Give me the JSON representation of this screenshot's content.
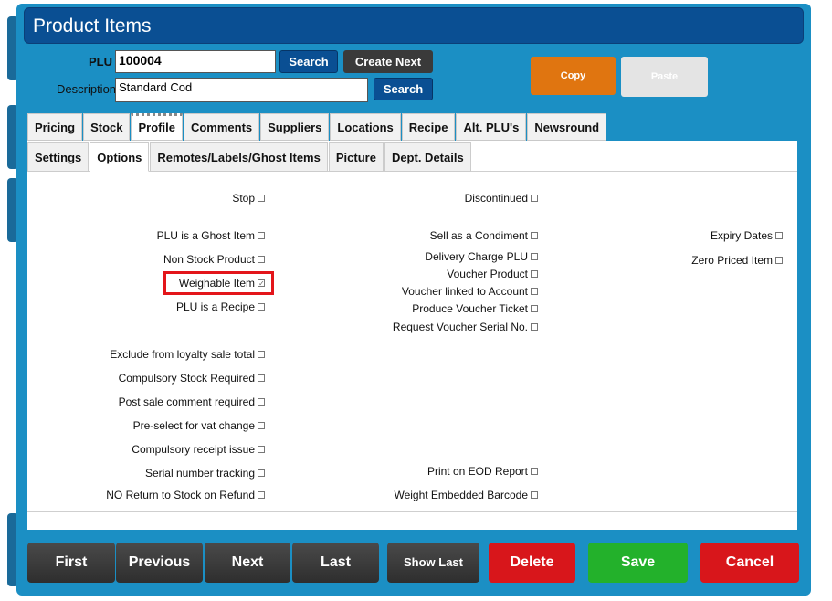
{
  "window": {
    "title": "Product Items"
  },
  "header": {
    "plu_label": "PLU",
    "plu_value": "100004",
    "description_label": "Description",
    "description_value": "Standard Cod",
    "search_label": "Search",
    "search2_label": "Search",
    "create_next_label": "Create Next",
    "copy_label": "Copy",
    "paste_label": "Paste"
  },
  "tabs": [
    "Pricing",
    "Stock",
    "Profile",
    "Comments",
    "Suppliers",
    "Locations",
    "Recipe",
    "Alt. PLU's",
    "Newsround"
  ],
  "active_tab": "Profile",
  "subtabs": [
    "Settings",
    "Options",
    "Remotes/Labels/Ghost Items",
    "Picture",
    "Dept. Details"
  ],
  "active_subtab": "Options",
  "options": {
    "col1": [
      {
        "label": "Stop",
        "checked": false
      },
      {
        "label": "PLU is a Ghost Item",
        "checked": false
      },
      {
        "label": "Non Stock Product",
        "checked": false
      },
      {
        "label": "Weighable Item",
        "checked": true
      },
      {
        "label": "PLU is a Recipe",
        "checked": false
      },
      {
        "label": "Exclude from loyalty sale total",
        "checked": false
      },
      {
        "label": "Compulsory Stock Required",
        "checked": false
      },
      {
        "label": "Post sale comment required",
        "checked": false
      },
      {
        "label": "Pre-select for vat change",
        "checked": false
      },
      {
        "label": "Compulsory receipt issue",
        "checked": false
      },
      {
        "label": "Serial number tracking",
        "checked": false
      },
      {
        "label": "NO Return to Stock on Refund",
        "checked": false
      }
    ],
    "col2": [
      {
        "label": "Discontinued",
        "checked": false
      },
      {
        "label": "Sell as a Condiment",
        "checked": false
      },
      {
        "label": "Delivery Charge PLU",
        "checked": false
      },
      {
        "label": "Voucher Product",
        "checked": false
      },
      {
        "label": "Voucher linked to Account",
        "checked": false
      },
      {
        "label": "Produce Voucher Ticket",
        "checked": false
      },
      {
        "label": "Request Voucher Serial No.",
        "checked": false
      },
      {
        "label": "Print on EOD Report",
        "checked": false
      },
      {
        "label": "Weight Embedded Barcode",
        "checked": false
      }
    ],
    "col3": [
      {
        "label": "Expiry Dates",
        "checked": false
      },
      {
        "label": "Zero Priced Item",
        "checked": false
      }
    ]
  },
  "nav": {
    "first": "First",
    "previous": "Previous",
    "next": "Next",
    "last": "Last",
    "show_last": "Show Last",
    "delete": "Delete",
    "save": "Save",
    "cancel": "Cancel"
  },
  "colors": {
    "frame": "#1b8fc4",
    "titlebar": "#0a4f93",
    "copy": "#e07510",
    "delete": "#d8161b",
    "save": "#23b12b",
    "cancel": "#d8161b",
    "highlight": "#e3151a"
  }
}
